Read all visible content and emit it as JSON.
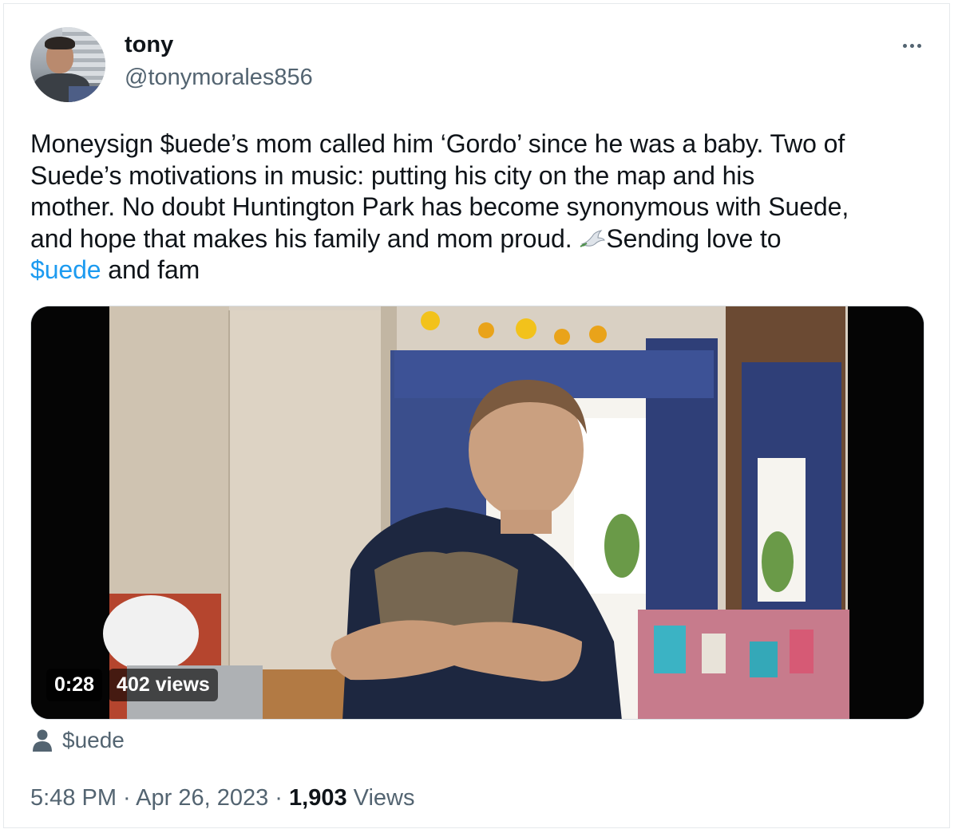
{
  "author": {
    "display_name": "tony",
    "handle": "@tonymorales856"
  },
  "tweet": {
    "lines": [
      "Moneysign $uede’s mom called him ‘Gordo’ since he was a baby. Two of",
      "Suede’s motivations in music: putting his city on the map and his",
      "mother. No doubt Huntington Park has become synonymous with Suede,",
      "and hope that makes his family and mom proud. "
    ],
    "line4_tail": "Sending love to",
    "mention": "$uede",
    "ending": " and fam",
    "emoji": "dove"
  },
  "video": {
    "duration": "0:28",
    "views": "402 views"
  },
  "attribution": {
    "label": "$uede",
    "icon": "person-icon"
  },
  "meta": {
    "time": "5:48 PM",
    "date": "Apr 26, 2023",
    "separator": " · ",
    "view_count": "1,903",
    "view_label": " Views"
  },
  "colors": {
    "link": "#1d9bf0",
    "secondary_text": "#536471",
    "primary_text": "#0f1419"
  }
}
